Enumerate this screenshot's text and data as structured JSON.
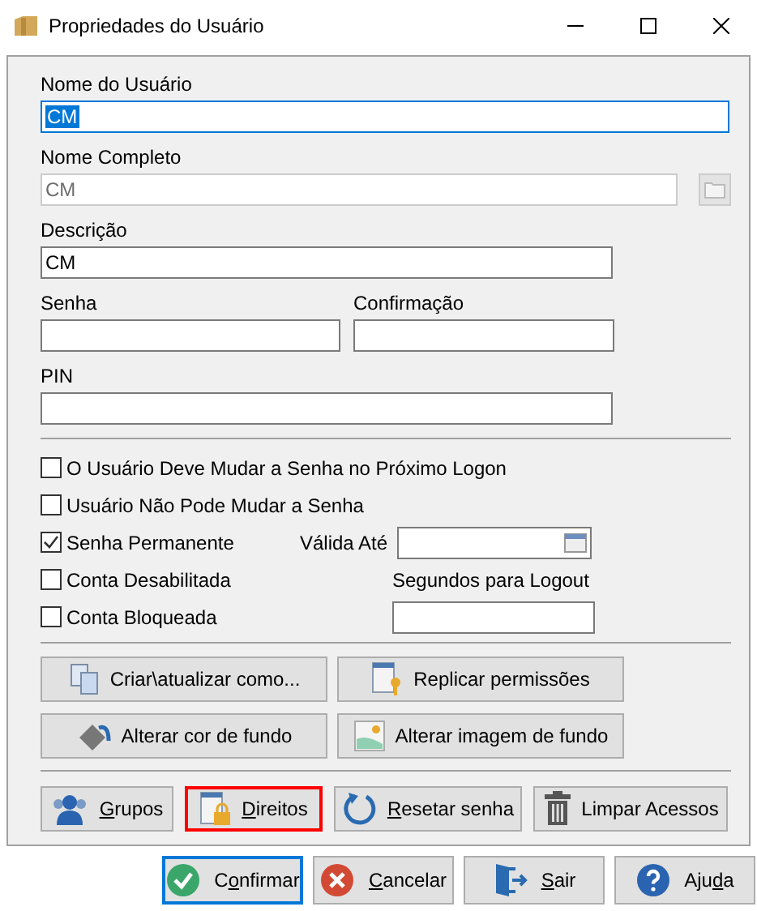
{
  "window": {
    "title": "Propriedades do Usuário"
  },
  "user_name": {
    "label": "Nome do Usuário",
    "value": "CM",
    "text_selected": true
  },
  "full_name": {
    "label": "Nome Completo",
    "value": "CM",
    "disabled": true
  },
  "description": {
    "label": "Descrição",
    "value": "CM"
  },
  "password": {
    "label": "Senha"
  },
  "confirmation": {
    "label": "Confirmação"
  },
  "pin": {
    "label": "PIN"
  },
  "options": [
    {
      "label": "O Usuário Deve Mudar a Senha no Próximo Logon",
      "checked": false
    },
    {
      "label": "Usuário Não Pode Mudar a Senha",
      "checked": false
    },
    {
      "label": "Senha Permanente",
      "checked": true
    },
    {
      "label": "Conta Desabilitada",
      "checked": false
    },
    {
      "label": "Conta Bloqueada",
      "checked": false
    }
  ],
  "valid_until": {
    "label": "Válida Até"
  },
  "logout_seconds": {
    "label": "Segundos para Logout"
  },
  "action_buttons": [
    {
      "label": "Criar\\atualizar como...",
      "kind": "copy"
    },
    {
      "label": "Replicar permissões",
      "kind": "key"
    },
    {
      "label": "Alterar cor de fundo",
      "kind": "paint"
    },
    {
      "label": "Alterar imagem de fundo",
      "kind": "image"
    }
  ],
  "user_buttons": [
    {
      "label_parts": [
        {
          "text": "G",
          "underlined": true
        },
        {
          "text": "rupos",
          "underlined": false
        }
      ],
      "kind": "users",
      "highlighted": false
    },
    {
      "label_parts": [
        {
          "text": "D",
          "underlined": true
        },
        {
          "text": "ireitos",
          "underlined": false
        }
      ],
      "kind": "lock",
      "highlighted": true
    },
    {
      "label_parts": [
        {
          "text": "R",
          "underlined": true
        },
        {
          "text": "esetar senha",
          "underlined": false
        }
      ],
      "kind": "reset",
      "highlighted": false
    },
    {
      "label_parts": [
        {
          "text": "Limpar Acessos",
          "underlined": false
        }
      ],
      "kind": "trash",
      "highlighted": false
    }
  ],
  "dialog_buttons": [
    {
      "label_parts": [
        {
          "text": "C",
          "underlined": false
        },
        {
          "text": "o",
          "underlined": true
        },
        {
          "text": "nfirmar",
          "underlined": false
        }
      ],
      "kind": "ok",
      "focused": true
    },
    {
      "label_parts": [
        {
          "text": "C",
          "underlined": true
        },
        {
          "text": "ancelar",
          "underlined": false
        }
      ],
      "kind": "cancel",
      "focused": false
    },
    {
      "label_parts": [
        {
          "text": "S",
          "underlined": true
        },
        {
          "text": "air",
          "underlined": false
        }
      ],
      "kind": "exit",
      "focused": false
    },
    {
      "label_parts": [
        {
          "text": "Aju",
          "underlined": false
        },
        {
          "text": "d",
          "underlined": true
        },
        {
          "text": "a",
          "underlined": false
        }
      ],
      "kind": "help",
      "focused": false
    }
  ]
}
